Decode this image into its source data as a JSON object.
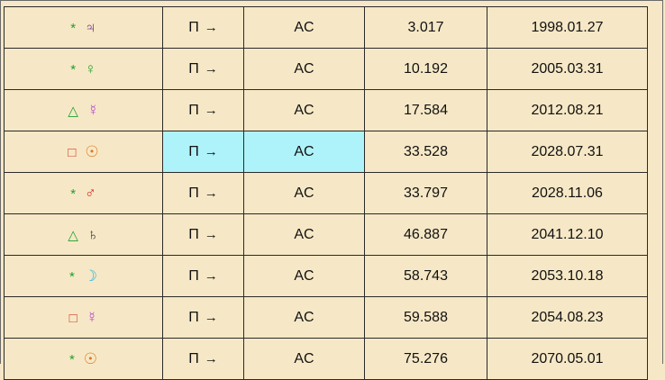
{
  "table": {
    "rows": [
      {
        "aspect_symbol": "*",
        "aspect_color": "#1f9e2e",
        "planet_symbol": "♃",
        "planet_color": "#6a2b8c",
        "direction": "Π",
        "arrow": "→",
        "angle": "AC",
        "arc": "3.017",
        "date": "1998.01.27"
      },
      {
        "aspect_symbol": "*",
        "aspect_color": "#1f9e2e",
        "planet_symbol": "♀",
        "planet_color": "#2e9d2e",
        "direction": "Π",
        "arrow": "→",
        "angle": "AC",
        "arc": "10.192",
        "date": "2005.03.31"
      },
      {
        "aspect_symbol": "△",
        "aspect_color": "#1f9e2e",
        "planet_symbol": "☿",
        "planet_color": "#b23fcf",
        "direction": "Π",
        "arrow": "→",
        "angle": "AC",
        "arc": "17.584",
        "date": "2012.08.21"
      },
      {
        "aspect_symbol": "□",
        "aspect_color": "#d23a2a",
        "planet_symbol": "☉",
        "planet_color": "#e0761a",
        "direction": "Π",
        "arrow": "→",
        "angle": "AC",
        "arc": "33.528",
        "date": "2028.07.31"
      },
      {
        "aspect_symbol": "*",
        "aspect_color": "#1f9e2e",
        "planet_symbol": "♂",
        "planet_color": "#d22a2a",
        "direction": "Π",
        "arrow": "→",
        "angle": "AC",
        "arc": "33.797",
        "date": "2028.11.06"
      },
      {
        "aspect_symbol": "△",
        "aspect_color": "#1f9e2e",
        "planet_symbol": "♄",
        "planet_color": "#3a3a3a",
        "direction": "Π",
        "arrow": "→",
        "angle": "AC",
        "arc": "46.887",
        "date": "2041.12.10"
      },
      {
        "aspect_symbol": "*",
        "aspect_color": "#1f9e2e",
        "planet_symbol": "☽",
        "planet_color": "#2ab3e0",
        "direction": "Π",
        "arrow": "→",
        "angle": "AC",
        "arc": "58.743",
        "date": "2053.10.18"
      },
      {
        "aspect_symbol": "□",
        "aspect_color": "#d23a2a",
        "planet_symbol": "☿",
        "planet_color": "#b23fcf",
        "direction": "Π",
        "arrow": "→",
        "angle": "AC",
        "arc": "59.588",
        "date": "2054.08.23"
      },
      {
        "aspect_symbol": "*",
        "aspect_color": "#1f9e2e",
        "planet_symbol": "☉",
        "planet_color": "#e0761a",
        "direction": "Π",
        "arrow": "→",
        "angle": "AC",
        "arc": "75.276",
        "date": "2070.05.01"
      }
    ]
  },
  "selection": {
    "row_index": 3,
    "highlight_color": "#aef3f9"
  },
  "colors": {
    "background": "#f6e8c6",
    "border": "#2a2a2a"
  }
}
